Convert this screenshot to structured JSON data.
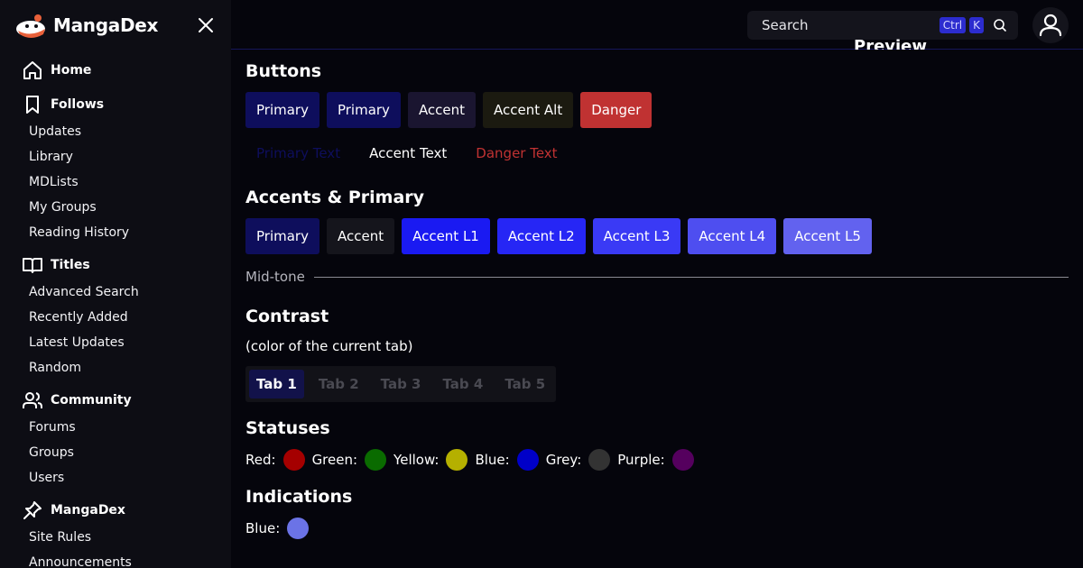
{
  "brand": {
    "name": "MangaDex"
  },
  "sidebar": {
    "sections": [
      {
        "title": "Home",
        "icon": "home-icon",
        "items": []
      },
      {
        "title": "Follows",
        "icon": "bookmark-icon",
        "items": [
          "Updates",
          "Library",
          "MDLists",
          "My Groups",
          "Reading History"
        ]
      },
      {
        "title": "Titles",
        "icon": "book-open-icon",
        "items": [
          "Advanced Search",
          "Recently Added",
          "Latest Updates",
          "Random"
        ]
      },
      {
        "title": "Community",
        "icon": "users-icon",
        "items": [
          "Forums",
          "Groups",
          "Users"
        ]
      },
      {
        "title": "MangaDex",
        "icon": "pin-icon",
        "items": [
          "Site Rules",
          "Announcements"
        ]
      }
    ]
  },
  "topbar": {
    "search_placeholder": "Search",
    "kbd_ctrl": "Ctrl",
    "kbd_k": "K",
    "peek_title": "Preview"
  },
  "main": {
    "buttons_title": "Buttons",
    "buttons": [
      {
        "label": "Primary",
        "bg": "#0e0e5c"
      },
      {
        "label": "Primary",
        "bg": "#0e0e5c"
      },
      {
        "label": "Accent",
        "bg": "#1a1530"
      },
      {
        "label": "Accent Alt",
        "bg": "#1b1a10"
      },
      {
        "label": "Danger",
        "bg": "#c03232"
      }
    ],
    "text_buttons": [
      {
        "label": "Primary Text",
        "color": "#0e0e5c"
      },
      {
        "label": "Accent Text",
        "color": "#ffffff"
      },
      {
        "label": "Danger Text",
        "color": "#c03232"
      }
    ],
    "accents_title": "Accents & Primary",
    "accents": [
      {
        "label": "Primary",
        "bg": "#0e0e5c"
      },
      {
        "label": "Accent",
        "bg": "#15151c"
      },
      {
        "label": "Accent L1",
        "bg": "#1a1af2"
      },
      {
        "label": "Accent L2",
        "bg": "#2626f5"
      },
      {
        "label": "Accent L3",
        "bg": "#3a3af5"
      },
      {
        "label": "Accent L4",
        "bg": "#4e4ef0"
      },
      {
        "label": "Accent L5",
        "bg": "#6262ef"
      }
    ],
    "midtone_label": "Mid-tone",
    "contrast_title": "Contrast",
    "contrast_subtitle": "(color of the current tab)",
    "tabs": [
      "Tab 1",
      "Tab 2",
      "Tab 3",
      "Tab 4",
      "Tab 5"
    ],
    "statuses_title": "Statuses",
    "statuses": [
      {
        "label": "Red:",
        "color": "#a50000"
      },
      {
        "label": "Green:",
        "color": "#0a6b00"
      },
      {
        "label": "Yellow:",
        "color": "#b5b000"
      },
      {
        "label": "Blue:",
        "color": "#0000c8"
      },
      {
        "label": "Grey:",
        "color": "#333333"
      },
      {
        "label": "Purple:",
        "color": "#55005e"
      }
    ],
    "indications_title": "Indications",
    "indications": [
      {
        "label": "Blue:",
        "color": "#6b73e6"
      }
    ]
  }
}
